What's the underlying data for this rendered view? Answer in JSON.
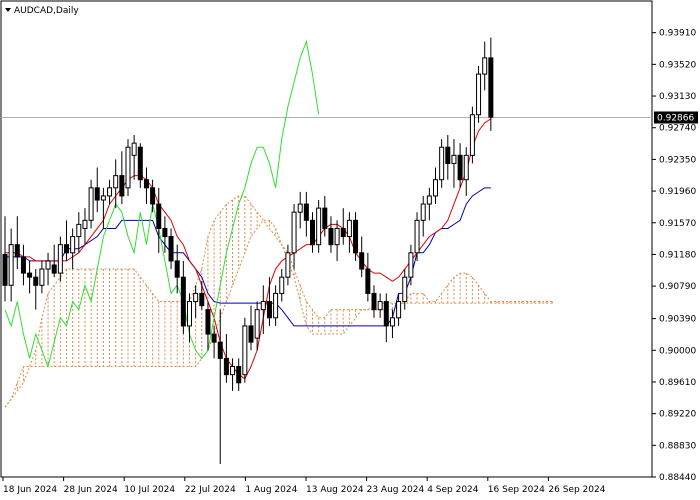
{
  "title": "AUDCAD,Daily",
  "chart_data": {
    "type": "candlestick",
    "symbol": "AUDCAD",
    "timeframe": "Daily",
    "ylim": [
      0.8844,
      0.943
    ],
    "y_ticks": [
      "0.93910",
      "0.93520",
      "0.93130",
      "0.92740",
      "0.92350",
      "0.91960",
      "0.91570",
      "0.91180",
      "0.90790",
      "0.90390",
      "0.90000",
      "0.89610",
      "0.89220",
      "0.88830",
      "0.88440"
    ],
    "x_ticks": [
      "18 Jun 2024",
      "28 Jun 2024",
      "10 Jul 2024",
      "22 Jul 2024",
      "1 Aug 2024",
      "13 Aug 2024",
      "23 Aug 2024",
      "4 Sep 2024",
      "16 Sep 2024",
      "26 Sep 2024"
    ],
    "current_price": "0.92866",
    "colors": {
      "tenkan": "#e00000",
      "kijun": "#0000b0",
      "chikou": "#33dd33",
      "cloud": "#d98c4a",
      "price_line": "#b0b0b0"
    },
    "candles": [
      [
        0.9118,
        0.9165,
        0.906,
        0.908
      ],
      [
        0.908,
        0.915,
        0.906,
        0.913
      ],
      [
        0.913,
        0.9165,
        0.91,
        0.9115
      ],
      [
        0.9115,
        0.913,
        0.908,
        0.9095
      ],
      [
        0.9095,
        0.911,
        0.907,
        0.909
      ],
      [
        0.909,
        0.91,
        0.905,
        0.908
      ],
      [
        0.908,
        0.911,
        0.907,
        0.91
      ],
      [
        0.91,
        0.912,
        0.908,
        0.911
      ],
      [
        0.9105,
        0.913,
        0.909,
        0.9095
      ],
      [
        0.9095,
        0.914,
        0.9085,
        0.913
      ],
      [
        0.913,
        0.916,
        0.911,
        0.912
      ],
      [
        0.912,
        0.915,
        0.91,
        0.914
      ],
      [
        0.914,
        0.917,
        0.912,
        0.9155
      ],
      [
        0.915,
        0.9175,
        0.913,
        0.916
      ],
      [
        0.916,
        0.921,
        0.915,
        0.92
      ],
      [
        0.92,
        0.9225,
        0.917,
        0.9185
      ],
      [
        0.9185,
        0.92,
        0.915,
        0.919
      ],
      [
        0.919,
        0.921,
        0.918,
        0.92
      ],
      [
        0.92,
        0.9235,
        0.9175,
        0.9215
      ],
      [
        0.9215,
        0.9245,
        0.918,
        0.919
      ],
      [
        0.92,
        0.926,
        0.919,
        0.925
      ],
      [
        0.924,
        0.9265,
        0.921,
        0.9255
      ],
      [
        0.925,
        0.9255,
        0.92,
        0.921
      ],
      [
        0.921,
        0.9225,
        0.918,
        0.92
      ],
      [
        0.92,
        0.921,
        0.917,
        0.918
      ],
      [
        0.918,
        0.92,
        0.912,
        0.915
      ],
      [
        0.915,
        0.9165,
        0.912,
        0.914
      ],
      [
        0.914,
        0.915,
        0.91,
        0.911
      ],
      [
        0.911,
        0.913,
        0.907,
        0.909
      ],
      [
        0.909,
        0.911,
        0.902,
        0.903
      ],
      [
        0.903,
        0.907,
        0.901,
        0.906
      ],
      [
        0.906,
        0.908,
        0.904,
        0.907
      ],
      [
        0.907,
        0.9085,
        0.905,
        0.9055
      ],
      [
        0.905,
        0.906,
        0.9,
        0.902
      ],
      [
        0.902,
        0.903,
        0.899,
        0.901
      ],
      [
        0.901,
        0.905,
        0.886,
        0.899
      ],
      [
        0.899,
        0.902,
        0.896,
        0.897
      ],
      [
        0.897,
        0.899,
        0.895,
        0.898
      ],
      [
        0.898,
        0.899,
        0.895,
        0.896
      ],
      [
        0.897,
        0.904,
        0.896,
        0.903
      ],
      [
        0.903,
        0.9055,
        0.9,
        0.901
      ],
      [
        0.9015,
        0.906,
        0.9,
        0.905
      ],
      [
        0.905,
        0.908,
        0.902,
        0.906
      ],
      [
        0.906,
        0.909,
        0.903,
        0.904
      ],
      [
        0.904,
        0.908,
        0.903,
        0.907
      ],
      [
        0.907,
        0.91,
        0.906,
        0.909
      ],
      [
        0.909,
        0.913,
        0.908,
        0.912
      ],
      [
        0.912,
        0.918,
        0.91,
        0.917
      ],
      [
        0.917,
        0.9195,
        0.915,
        0.918
      ],
      [
        0.918,
        0.9195,
        0.914,
        0.916
      ],
      [
        0.916,
        0.917,
        0.912,
        0.913
      ],
      [
        0.913,
        0.9185,
        0.912,
        0.9175
      ],
      [
        0.9175,
        0.919,
        0.914,
        0.915
      ],
      [
        0.915,
        0.9165,
        0.912,
        0.913
      ],
      [
        0.913,
        0.916,
        0.911,
        0.915
      ],
      [
        0.915,
        0.9175,
        0.913,
        0.914
      ],
      [
        0.914,
        0.917,
        0.912,
        0.916
      ],
      [
        0.916,
        0.917,
        0.911,
        0.912
      ],
      [
        0.912,
        0.914,
        0.909,
        0.91
      ],
      [
        0.91,
        0.912,
        0.906,
        0.907
      ],
      [
        0.907,
        0.908,
        0.904,
        0.905
      ],
      [
        0.905,
        0.907,
        0.904,
        0.906
      ],
      [
        0.906,
        0.907,
        0.901,
        0.903
      ],
      [
        0.903,
        0.905,
        0.9015,
        0.904
      ],
      [
        0.904,
        0.907,
        0.903,
        0.906
      ],
      [
        0.906,
        0.91,
        0.905,
        0.909
      ],
      [
        0.909,
        0.913,
        0.908,
        0.912
      ],
      [
        0.912,
        0.917,
        0.911,
        0.916
      ],
      [
        0.916,
        0.919,
        0.914,
        0.918
      ],
      [
        0.918,
        0.92,
        0.916,
        0.919
      ],
      [
        0.919,
        0.9225,
        0.918,
        0.921
      ],
      [
        0.921,
        0.926,
        0.92,
        0.925
      ],
      [
        0.925,
        0.9265,
        0.921,
        0.923
      ],
      [
        0.923,
        0.926,
        0.92,
        0.924
      ],
      [
        0.924,
        0.9255,
        0.92,
        0.921
      ],
      [
        0.921,
        0.925,
        0.919,
        0.924
      ],
      [
        0.924,
        0.93,
        0.923,
        0.929
      ],
      [
        0.929,
        0.935,
        0.928,
        0.934
      ],
      [
        0.934,
        0.938,
        0.932,
        0.936
      ],
      [
        0.936,
        0.9385,
        0.927,
        0.9287
      ]
    ],
    "tenkan": [
      0.912,
      0.912,
      0.912,
      0.9115,
      0.9115,
      0.911,
      0.911,
      0.911,
      0.911,
      0.911,
      0.911,
      0.9115,
      0.912,
      0.913,
      0.914,
      0.915,
      0.916,
      0.918,
      0.919,
      0.92,
      0.921,
      0.9215,
      0.9215,
      0.921,
      0.92,
      0.918,
      0.917,
      0.916,
      0.914,
      0.913,
      0.911,
      0.91,
      0.908,
      0.906,
      0.904,
      0.901,
      0.899,
      0.898,
      0.897,
      0.8965,
      0.898,
      0.9,
      0.904,
      0.908,
      0.91,
      0.911,
      0.9115,
      0.912,
      0.9125,
      0.913,
      0.913,
      0.914,
      0.915,
      0.9155,
      0.9155,
      0.915,
      0.914,
      0.912,
      0.911,
      0.91,
      0.9095,
      0.9095,
      0.909,
      0.9085,
      0.909,
      0.91,
      0.911,
      0.912,
      0.913,
      0.914,
      0.9145,
      0.915,
      0.916,
      0.918,
      0.92,
      0.922,
      0.925,
      0.927,
      0.928,
      0.9285
    ],
    "kijun": [
      0.9115,
      0.9115,
      0.9115,
      0.9115,
      0.911,
      0.911,
      0.911,
      0.911,
      0.911,
      0.911,
      0.9125,
      0.9125,
      0.9125,
      0.913,
      0.9135,
      0.914,
      0.915,
      0.915,
      0.915,
      0.916,
      0.916,
      0.916,
      0.916,
      0.916,
      0.916,
      0.914,
      0.913,
      0.912,
      0.912,
      0.912,
      0.911,
      0.91,
      0.909,
      0.907,
      0.906,
      0.9058,
      0.9058,
      0.9058,
      0.9058,
      0.9058,
      0.9058,
      0.9058,
      0.9058,
      0.9058,
      0.9058,
      0.905,
      0.904,
      0.903,
      0.903,
      0.903,
      0.903,
      0.903,
      0.903,
      0.903,
      0.903,
      0.903,
      0.903,
      0.903,
      0.903,
      0.903,
      0.903,
      0.903,
      0.903,
      0.904,
      0.907,
      0.907,
      0.909,
      0.912,
      0.912,
      0.913,
      0.9145,
      0.915,
      0.915,
      0.9155,
      0.916,
      0.918,
      0.919,
      0.9195,
      0.92,
      0.92
    ],
    "chikou": [
      0.905,
      0.903,
      0.906,
      0.902,
      0.899,
      0.902,
      0.9,
      0.898,
      0.901,
      0.904,
      0.903,
      0.906,
      0.905,
      0.908,
      0.906,
      0.91,
      0.914,
      0.916,
      0.918,
      0.917,
      0.914,
      0.912,
      0.917,
      0.913,
      0.918,
      0.915,
      0.911,
      0.907,
      0.908,
      0.906,
      0.902,
      0.9,
      0.899,
      0.9,
      0.904,
      0.908,
      0.912,
      0.915,
      0.918,
      0.92,
      0.923,
      0.925,
      0.925,
      0.923,
      0.92,
      0.926,
      0.93,
      0.933,
      0.936,
      0.938,
      0.934,
      0.929
    ],
    "cloud_a": [
      0.893,
      0.894,
      0.895,
      0.896,
      0.898,
      0.9,
      0.904,
      0.907,
      0.908,
      0.909,
      0.91,
      0.91,
      0.91,
      0.91,
      0.91,
      0.91,
      0.91,
      0.91,
      0.91,
      0.91,
      0.91,
      0.91,
      0.909,
      0.908,
      0.907,
      0.906,
      0.906,
      0.906,
      0.906,
      0.906,
      0.906,
      0.908,
      0.91,
      0.914,
      0.916,
      0.917,
      0.918,
      0.9185,
      0.919,
      0.919,
      0.918,
      0.917,
      0.916,
      0.915,
      0.914,
      0.913,
      0.912,
      0.91,
      0.908,
      0.906,
      0.905,
      0.904,
      0.904,
      0.905,
      0.905,
      0.905,
      0.905,
      0.905,
      0.905,
      0.905,
      0.905,
      0.905,
      0.905,
      0.905,
      0.9055,
      0.906,
      0.907,
      0.907,
      0.907,
      0.906,
      0.906,
      0.907,
      0.908,
      0.909,
      0.9095,
      0.9095,
      0.909,
      0.908,
      0.907,
      0.906,
      0.906,
      0.906,
      0.906,
      0.906,
      0.906,
      0.906,
      0.906,
      0.906,
      0.906,
      0.906
    ],
    "cloud_b": [
      0.893,
      0.894,
      0.896,
      0.898,
      0.898,
      0.898,
      0.898,
      0.898,
      0.898,
      0.898,
      0.898,
      0.898,
      0.898,
      0.898,
      0.898,
      0.898,
      0.898,
      0.898,
      0.898,
      0.898,
      0.898,
      0.898,
      0.898,
      0.898,
      0.898,
      0.898,
      0.898,
      0.898,
      0.898,
      0.898,
      0.898,
      0.898,
      0.899,
      0.9,
      0.902,
      0.904,
      0.906,
      0.908,
      0.91,
      0.912,
      0.914,
      0.915,
      0.916,
      0.916,
      0.915,
      0.913,
      0.911,
      0.909,
      0.906,
      0.903,
      0.902,
      0.902,
      0.902,
      0.902,
      0.902,
      0.902,
      0.903,
      0.904,
      0.905,
      0.905,
      0.9055,
      0.9058,
      0.9058,
      0.9058,
      0.9058,
      0.9058,
      0.9058,
      0.9058,
      0.9058,
      0.9058,
      0.9058,
      0.9058,
      0.9058,
      0.9058,
      0.9058,
      0.9058,
      0.9058,
      0.9058,
      0.9058,
      0.9058,
      0.9058,
      0.9058,
      0.9058,
      0.9058,
      0.9058,
      0.9058,
      0.9058,
      0.9058,
      0.9058,
      0.9058
    ]
  }
}
